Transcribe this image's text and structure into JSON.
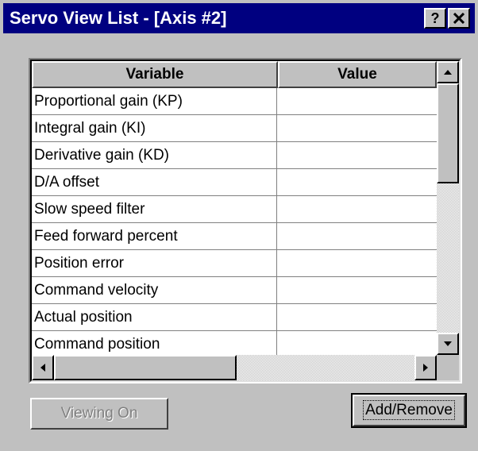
{
  "window": {
    "title": "Servo View List - [Axis #2]",
    "help_button": "?"
  },
  "table": {
    "columns": [
      "Variable",
      "Value"
    ],
    "rows": [
      {
        "variable": "Proportional gain (KP)",
        "value": ""
      },
      {
        "variable": "Integral gain (KI)",
        "value": ""
      },
      {
        "variable": "Derivative gain (KD)",
        "value": ""
      },
      {
        "variable": "D/A offset",
        "value": ""
      },
      {
        "variable": "Slow speed filter",
        "value": ""
      },
      {
        "variable": "Feed forward percent",
        "value": ""
      },
      {
        "variable": "Position error",
        "value": ""
      },
      {
        "variable": "Command velocity",
        "value": ""
      },
      {
        "variable": "Actual position",
        "value": ""
      },
      {
        "variable": "Command position",
        "value": ""
      }
    ]
  },
  "buttons": {
    "viewing_on": "Viewing On",
    "add_remove": "Add/Remove"
  },
  "icons": {
    "help": "question-mark-icon",
    "close": "close-x-icon",
    "scroll_up": "triangle-up-icon",
    "scroll_down": "triangle-down-icon",
    "scroll_left": "triangle-left-icon",
    "scroll_right": "triangle-right-icon"
  },
  "colors": {
    "titlebar": "#000080",
    "face": "#c0c0c0",
    "disabled_text": "#808080"
  }
}
